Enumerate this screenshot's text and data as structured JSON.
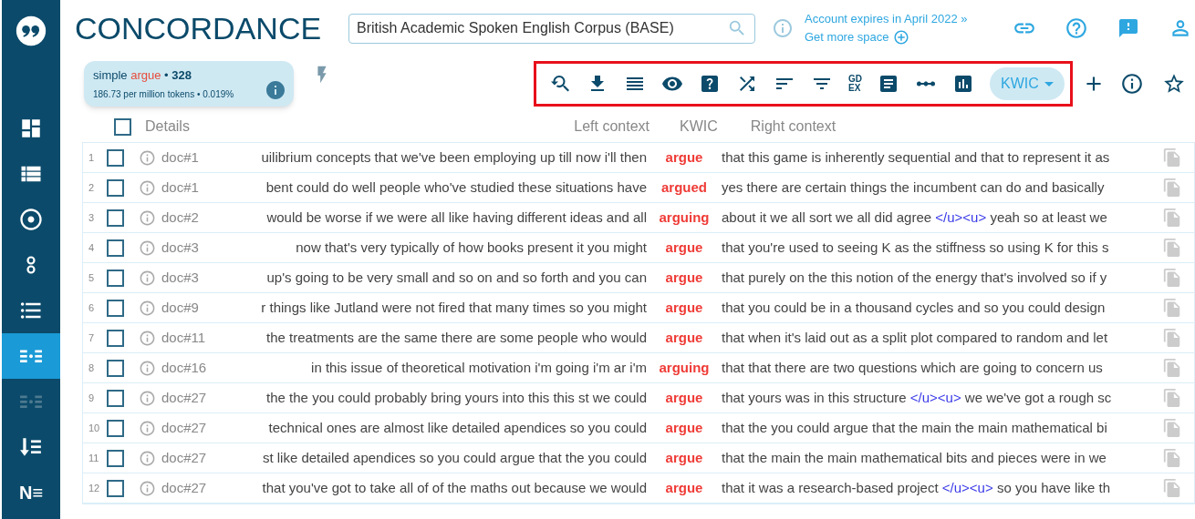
{
  "app": {
    "title": "CONCORDANCE"
  },
  "sidebar": {
    "items": [
      {
        "kind": "dashboard",
        "selected": false,
        "disabled": false
      },
      {
        "kind": "list",
        "selected": false,
        "disabled": false
      },
      {
        "kind": "target",
        "selected": false,
        "disabled": false
      },
      {
        "kind": "pair",
        "selected": false,
        "disabled": false
      },
      {
        "kind": "bullets",
        "selected": false,
        "disabled": false
      },
      {
        "kind": "kwic",
        "selected": true,
        "disabled": false
      },
      {
        "kind": "kwic",
        "selected": false,
        "disabled": true
      },
      {
        "kind": "sort",
        "selected": false,
        "disabled": false
      },
      {
        "kind": "text",
        "label": "N≡",
        "selected": false,
        "disabled": false
      }
    ]
  },
  "search": {
    "value": "British Academic Spoken English Corpus (BASE)"
  },
  "account": {
    "expiry": "Account expires in April 2022 »",
    "space": "Get more space"
  },
  "summary": {
    "query_type": "simple",
    "query": "argue",
    "separator": "•",
    "count": "328",
    "stats": "186.73 per million tokens • 0.019%"
  },
  "toolbar": {
    "gdex": [
      "GD",
      "EX"
    ],
    "view": "KWIC"
  },
  "table": {
    "select_all_checked": false,
    "headers": {
      "details": "Details",
      "left": "Left context",
      "kwic": "KWIC",
      "right": "Right context"
    },
    "rows": [
      {
        "n": "1",
        "checked": false,
        "doc": "doc#1",
        "left": "uilibrium concepts that we've been employing up till now i'll then",
        "kwic": "argue",
        "right": [
          {
            "kind": "text",
            "text": "that this game is inherently sequential and that to represent it as"
          }
        ]
      },
      {
        "n": "2",
        "checked": false,
        "doc": "doc#1",
        "left": "bent could do well people who've studied these situations have",
        "kwic": "argued",
        "right": [
          {
            "kind": "text",
            "text": "yes there are certain things the incumbent can do and basically"
          }
        ]
      },
      {
        "n": "3",
        "checked": false,
        "doc": "doc#2",
        "left": "would be worse if we were all like having different ideas and all",
        "kwic": "arguing",
        "right": [
          {
            "kind": "text",
            "text": "about it we all sort we all did agree"
          },
          {
            "kind": "tag",
            "text": "</u><u>"
          },
          {
            "kind": "text",
            "text": "yeah so at least we"
          }
        ]
      },
      {
        "n": "4",
        "checked": false,
        "doc": "doc#3",
        "left": "now that's very typically of how books present it you might",
        "kwic": "argue",
        "right": [
          {
            "kind": "text",
            "text": "that you're used to seeing K as the stiffness so using K for this s"
          }
        ]
      },
      {
        "n": "5",
        "checked": false,
        "doc": "doc#3",
        "left": "up's going to be very small and so on and so forth and you can",
        "kwic": "argue",
        "right": [
          {
            "kind": "text",
            "text": "that purely on the this notion of the energy that's involved so if y"
          }
        ]
      },
      {
        "n": "6",
        "checked": false,
        "doc": "doc#9",
        "left": "r things like Jutland were not fired that many times so you might",
        "kwic": "argue",
        "right": [
          {
            "kind": "text",
            "text": "that you could be in a thousand cycles and so you could design"
          }
        ]
      },
      {
        "n": "7",
        "checked": false,
        "doc": "doc#11",
        "left": "the treatments are the same there are some people who would",
        "kwic": "argue",
        "right": [
          {
            "kind": "text",
            "text": "that when it's laid out as a split plot compared to random and let"
          }
        ]
      },
      {
        "n": "8",
        "checked": false,
        "doc": "doc#16",
        "left": "in this issue of theoretical motivation i'm going i'm ar i'm",
        "kwic": "arguing",
        "right": [
          {
            "kind": "text",
            "text": "that that there are two questions which are going to concern us"
          }
        ]
      },
      {
        "n": "9",
        "checked": false,
        "doc": "doc#27",
        "left": "the the you could probably bring yours into this this st we could",
        "kwic": "argue",
        "right": [
          {
            "kind": "text",
            "text": "that yours was in this structure"
          },
          {
            "kind": "tag",
            "text": "</u><u>"
          },
          {
            "kind": "text",
            "text": "we we've got a rough sc"
          }
        ]
      },
      {
        "n": "10",
        "checked": false,
        "doc": "doc#27",
        "left": "technical ones are almost like detailed apendices so you could",
        "kwic": "argue",
        "right": [
          {
            "kind": "text",
            "text": "that the you could argue that the main the main mathematical bi"
          }
        ]
      },
      {
        "n": "11",
        "checked": false,
        "doc": "doc#27",
        "left": "st like detailed apendices so you could argue that the you could",
        "kwic": "argue",
        "right": [
          {
            "kind": "text",
            "text": "that the main the main mathematical bits and pieces were in we"
          }
        ]
      },
      {
        "n": "12",
        "checked": false,
        "doc": "doc#27",
        "left": "that you've got to take all of of the maths out because we would",
        "kwic": "argue",
        "right": [
          {
            "kind": "text",
            "text": "that it was a research-based project"
          },
          {
            "kind": "tag",
            "text": "</u><u>"
          },
          {
            "kind": "text",
            "text": "so you have like th"
          }
        ]
      }
    ]
  }
}
